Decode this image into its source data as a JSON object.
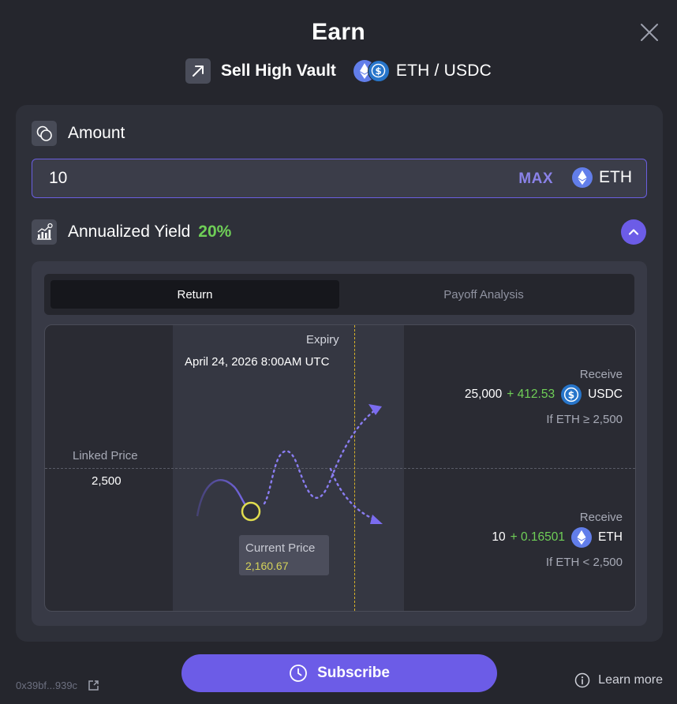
{
  "header": {
    "title": "Earn",
    "vault_name": "Sell High Vault",
    "pair": "ETH / USDC"
  },
  "amount": {
    "label": "Amount",
    "value": "10",
    "max_label": "MAX",
    "asset": "ETH"
  },
  "yield": {
    "label": "Annualized Yield",
    "value": "20%"
  },
  "tabs": [
    {
      "label": "Return",
      "active": true
    },
    {
      "label": "Payoff Analysis",
      "active": false
    }
  ],
  "chart": {
    "linked_price_label": "Linked Price",
    "linked_price_value": "2,500",
    "expiry_label": "Expiry",
    "expiry_date": "April 24, 2026 8:00AM UTC",
    "current_price_label": "Current Price",
    "current_price_value": "2,160.67",
    "upper": {
      "receive_label": "Receive",
      "amount": "25,000",
      "bonus": "+ 412.53",
      "asset": "USDC",
      "condition": "If ETH ≥ 2,500"
    },
    "lower": {
      "receive_label": "Receive",
      "amount": "10",
      "bonus": "+ 0.16501",
      "asset": "ETH",
      "condition": "If ETH < 2,500"
    }
  },
  "footer": {
    "subscribe_label": "Subscribe",
    "address": "0x39bf...939c",
    "learn_more": "Learn more"
  },
  "colors": {
    "accent": "#6c5ce7",
    "positive": "#6fcf57",
    "expiry_line": "#d8b32a",
    "current_price_marker": "#e0dd4f",
    "eth": "#627eea",
    "usdc": "#2775ca"
  }
}
